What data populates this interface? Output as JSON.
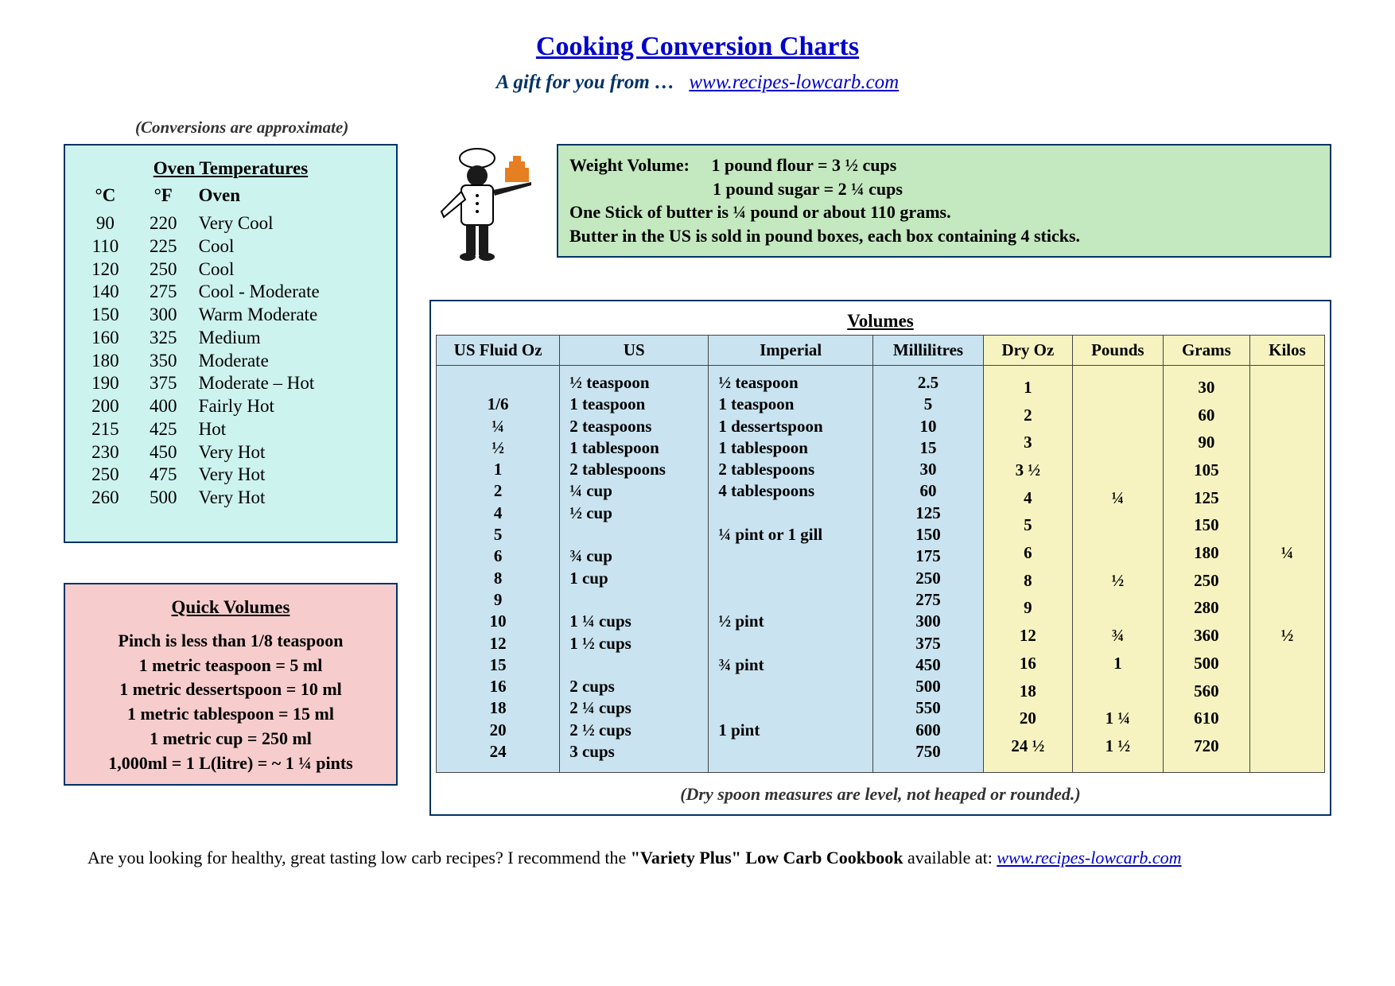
{
  "title": "Cooking Conversion Charts",
  "subtitle_prefix": "A gift for you from …",
  "subtitle_link": "www.recipes-lowcarb.com",
  "approx_note": "(Conversions are approximate)",
  "oven": {
    "title": "Oven Temperatures",
    "headers": [
      "°C",
      "°F",
      "Oven"
    ],
    "rows": [
      [
        "90",
        "220",
        "Very Cool"
      ],
      [
        "110",
        "225",
        "Cool"
      ],
      [
        "120",
        "250",
        "Cool"
      ],
      [
        "140",
        "275",
        "Cool - Moderate"
      ],
      [
        "150",
        "300",
        "Warm Moderate"
      ],
      [
        "160",
        "325",
        "Medium"
      ],
      [
        "180",
        "350",
        "Moderate"
      ],
      [
        "190",
        "375",
        "Moderate – Hot"
      ],
      [
        "200",
        "400",
        "Fairly Hot"
      ],
      [
        "215",
        "425",
        "Hot"
      ],
      [
        "230",
        "450",
        "Very Hot"
      ],
      [
        "250",
        "475",
        "Very Hot"
      ],
      [
        "260",
        "500",
        "Very Hot"
      ]
    ]
  },
  "quick": {
    "title": "Quick Volumes",
    "lines": [
      "Pinch is less than 1/8 teaspoon",
      "1 metric teaspoon = 5 ml",
      "1 metric dessertspoon = 10 ml",
      "1 metric tablespoon = 15 ml",
      "1 metric cup = 250 ml",
      "1,000ml = 1 L(litre) = ~ 1 ¼ pints"
    ]
  },
  "weight_box": {
    "line1a": "Weight Volume:",
    "line1b": "1 pound flour = 3 ½ cups",
    "line2": "1 pound sugar = 2 ¼ cups",
    "line3": "One Stick of butter is ¼ pound or about 110 grams.",
    "line4": "Butter in the US is sold in pound boxes, each box containing 4 sticks."
  },
  "volumes": {
    "title": "Volumes",
    "liquid_headers": [
      "US Fluid Oz",
      "US",
      "Imperial",
      "Millilitres"
    ],
    "dry_headers": [
      "Dry Oz",
      "Pounds",
      "Grams",
      "Kilos"
    ],
    "rows": [
      {
        "oz": "",
        "us": "½ teaspoon",
        "imp": "½ teaspoon",
        "ml": "2.5",
        "doz": "",
        "lb": "",
        "g": "",
        "kg": ""
      },
      {
        "oz": "1/6",
        "us": "1 teaspoon",
        "imp": "1 teaspoon",
        "ml": "5",
        "doz": "",
        "lb": "",
        "g": "",
        "kg": ""
      },
      {
        "oz": "¼",
        "us": "2 teaspoons",
        "imp": "1 dessertspoon",
        "ml": "10",
        "doz": "1",
        "lb": "",
        "g": "30",
        "kg": ""
      },
      {
        "oz": "½",
        "us": "1 tablespoon",
        "imp": "1 tablespoon",
        "ml": "15",
        "doz": "2",
        "lb": "",
        "g": "60",
        "kg": ""
      },
      {
        "oz": "1",
        "us": "2 tablespoons",
        "imp": "2 tablespoons",
        "ml": "30",
        "doz": "3",
        "lb": "",
        "g": "90",
        "kg": ""
      },
      {
        "oz": "2",
        "us": "¼ cup",
        "imp": "4 tablespoons",
        "ml": "60",
        "doz": "3 ½",
        "lb": "",
        "g": "105",
        "kg": ""
      },
      {
        "oz": "4",
        "us": "½ cup",
        "imp": "",
        "ml": "125",
        "doz": "4",
        "lb": "¼",
        "g": "125",
        "kg": ""
      },
      {
        "oz": "5",
        "us": "",
        "imp": "¼ pint or 1 gill",
        "ml": "150",
        "doz": "5",
        "lb": "",
        "g": "150",
        "kg": ""
      },
      {
        "oz": "6",
        "us": "¾ cup",
        "imp": "",
        "ml": "175",
        "doz": "6",
        "lb": "",
        "g": "180",
        "kg": "¼"
      },
      {
        "oz": "8",
        "us": "1 cup",
        "imp": "",
        "ml": "250",
        "doz": "8",
        "lb": "½",
        "g": "250",
        "kg": ""
      },
      {
        "oz": "9",
        "us": "",
        "imp": "",
        "ml": "275",
        "doz": "9",
        "lb": "",
        "g": "280",
        "kg": ""
      },
      {
        "oz": "10",
        "us": "1 ¼ cups",
        "imp": "½ pint",
        "ml": "300",
        "doz": "12",
        "lb": "¾",
        "g": "360",
        "kg": "½"
      },
      {
        "oz": "12",
        "us": "1 ½ cups",
        "imp": "",
        "ml": "375",
        "doz": "16",
        "lb": "1",
        "g": "500",
        "kg": ""
      },
      {
        "oz": "15",
        "us": "",
        "imp": "¾ pint",
        "ml": "450",
        "doz": "18",
        "lb": "",
        "g": "560",
        "kg": ""
      },
      {
        "oz": "16",
        "us": "2 cups",
        "imp": "",
        "ml": "500",
        "doz": "20",
        "lb": "1 ¼",
        "g": "610",
        "kg": ""
      },
      {
        "oz": "18",
        "us": "2 ¼ cups",
        "imp": "",
        "ml": "550",
        "doz": "24 ½",
        "lb": "1 ½",
        "g": "720",
        "kg": ""
      },
      {
        "oz": "20",
        "us": "2 ½ cups",
        "imp": "1 pint",
        "ml": "600",
        "doz": "",
        "lb": "",
        "g": "",
        "kg": ""
      },
      {
        "oz": "24",
        "us": "3 cups",
        "imp": "",
        "ml": "750",
        "doz": "",
        "lb": "",
        "g": "",
        "kg": ""
      }
    ],
    "note": "(Dry spoon measures are level, not heaped or rounded.)"
  },
  "footer": {
    "q": "Are you looking for healthy, great tasting low carb recipes?  I recommend the ",
    "book": "\"Variety Plus\" Low Carb Cookbook",
    "avail": " available at:  ",
    "link": "www.recipes-lowcarb.com"
  }
}
